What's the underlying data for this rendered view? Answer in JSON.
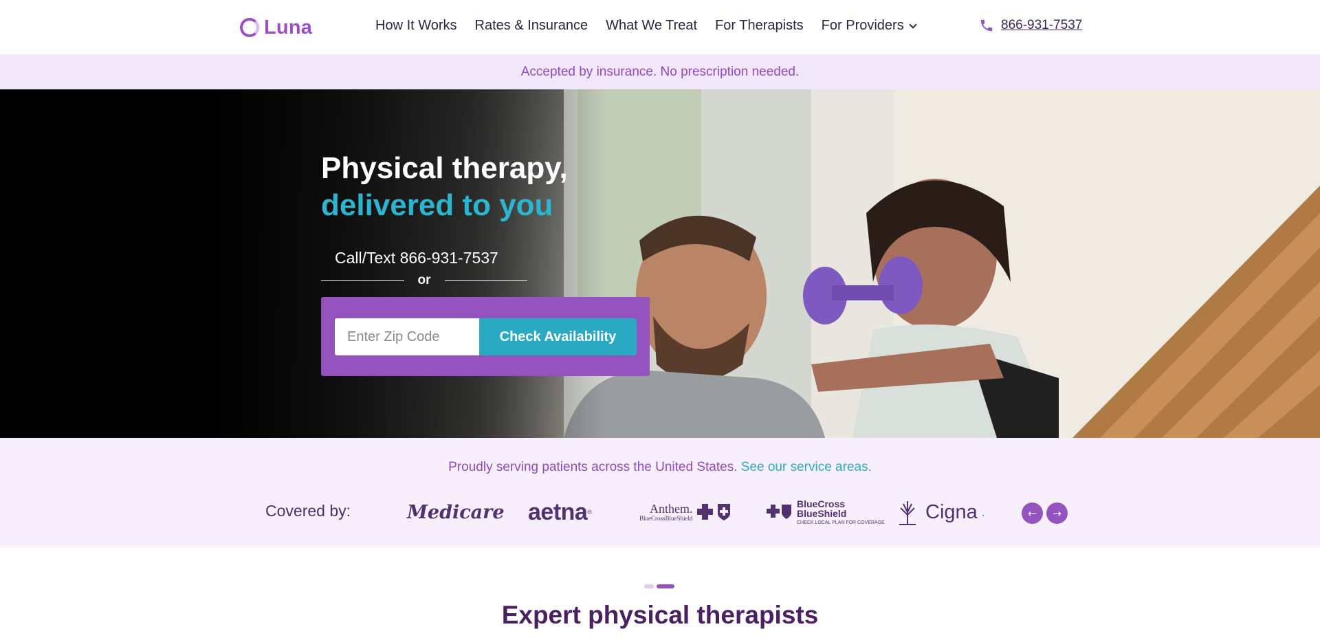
{
  "brand": {
    "name": "Luna",
    "color": "#9b4fc6"
  },
  "nav": {
    "items": [
      {
        "label": "How It Works"
      },
      {
        "label": "Rates & Insurance"
      },
      {
        "label": "What We Treat"
      },
      {
        "label": "For Therapists"
      },
      {
        "label": "For Providers",
        "has_dropdown": true
      }
    ],
    "phone": "866-931-7537",
    "phone_icon": "phone-icon"
  },
  "banner": {
    "text": "Accepted by insurance. No prescription needed."
  },
  "hero": {
    "title_line1": "Physical therapy,",
    "title_line2": "delivered to you",
    "call_text": "Call/Text 866-931-7537",
    "or_text": "or",
    "zip_placeholder": "Enter Zip Code",
    "zip_value": "",
    "check_button": "Check Availability",
    "accent_color": "#2ab6d0",
    "box_color": "#9452bf"
  },
  "coverage": {
    "serving_text": "Proudly serving patients across the United States.",
    "service_link": "See our service areas.",
    "covered_label": "Covered by:",
    "logos": {
      "medicare": "Medicare",
      "aetna": "aetna",
      "anthem_main": "Anthem.",
      "anthem_sub": "BlueCrossBlueShield",
      "bcbs_line1": "BlueCross",
      "bcbs_line2": "BlueShield",
      "bcbs_sub": "CHECK LOCAL PLAN FOR COVERAGE",
      "cigna": "Cigna"
    },
    "prev_icon": "arrow-left-icon",
    "next_icon": "arrow-right-icon"
  },
  "section": {
    "title": "Expert physical therapists",
    "carousel_active_index": 2
  }
}
